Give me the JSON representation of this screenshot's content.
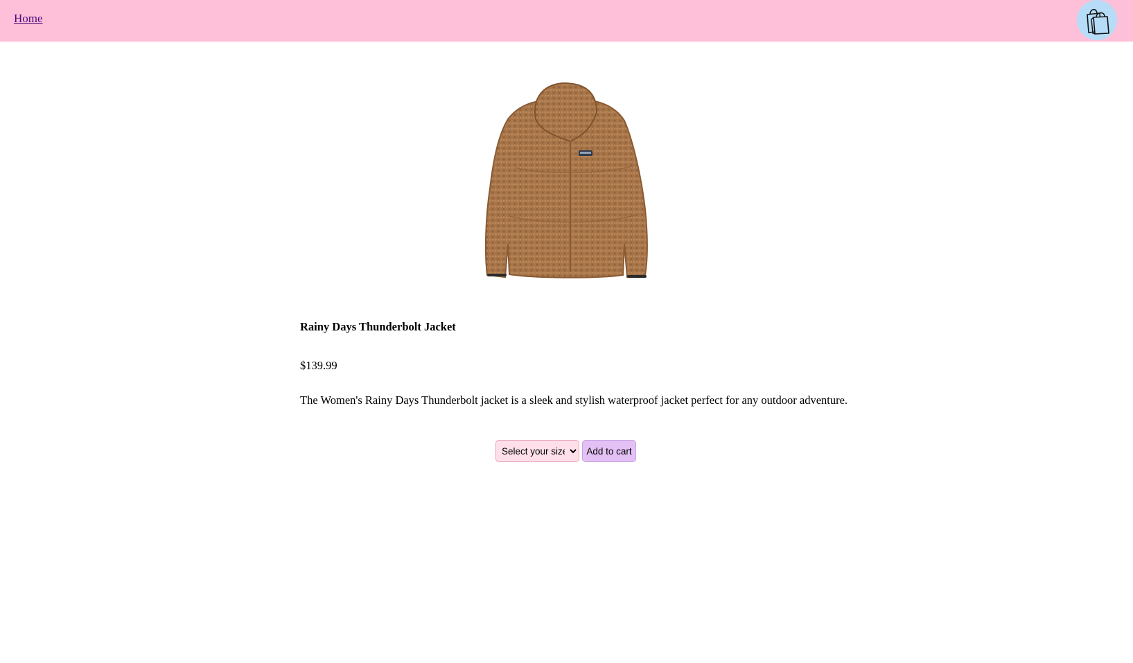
{
  "header": {
    "home_label": "Home",
    "background": "#fec0d9",
    "cart_icon": "shopping-bags-icon",
    "cart_background": "#b6dcf7"
  },
  "product": {
    "image": "brown-fleece-jacket",
    "title": "Rainy Days Thunderbolt Jacket",
    "price": "$139.99",
    "description": "The Women's Rainy Days Thunderbolt jacket is a sleek and stylish waterproof jacket perfect for any outdoor adventure."
  },
  "actions": {
    "size_select_value": "Select your size:",
    "add_to_cart_label": "Add to cart",
    "select_background": "#ffe0ea",
    "button_background": "#e3c1f5"
  }
}
